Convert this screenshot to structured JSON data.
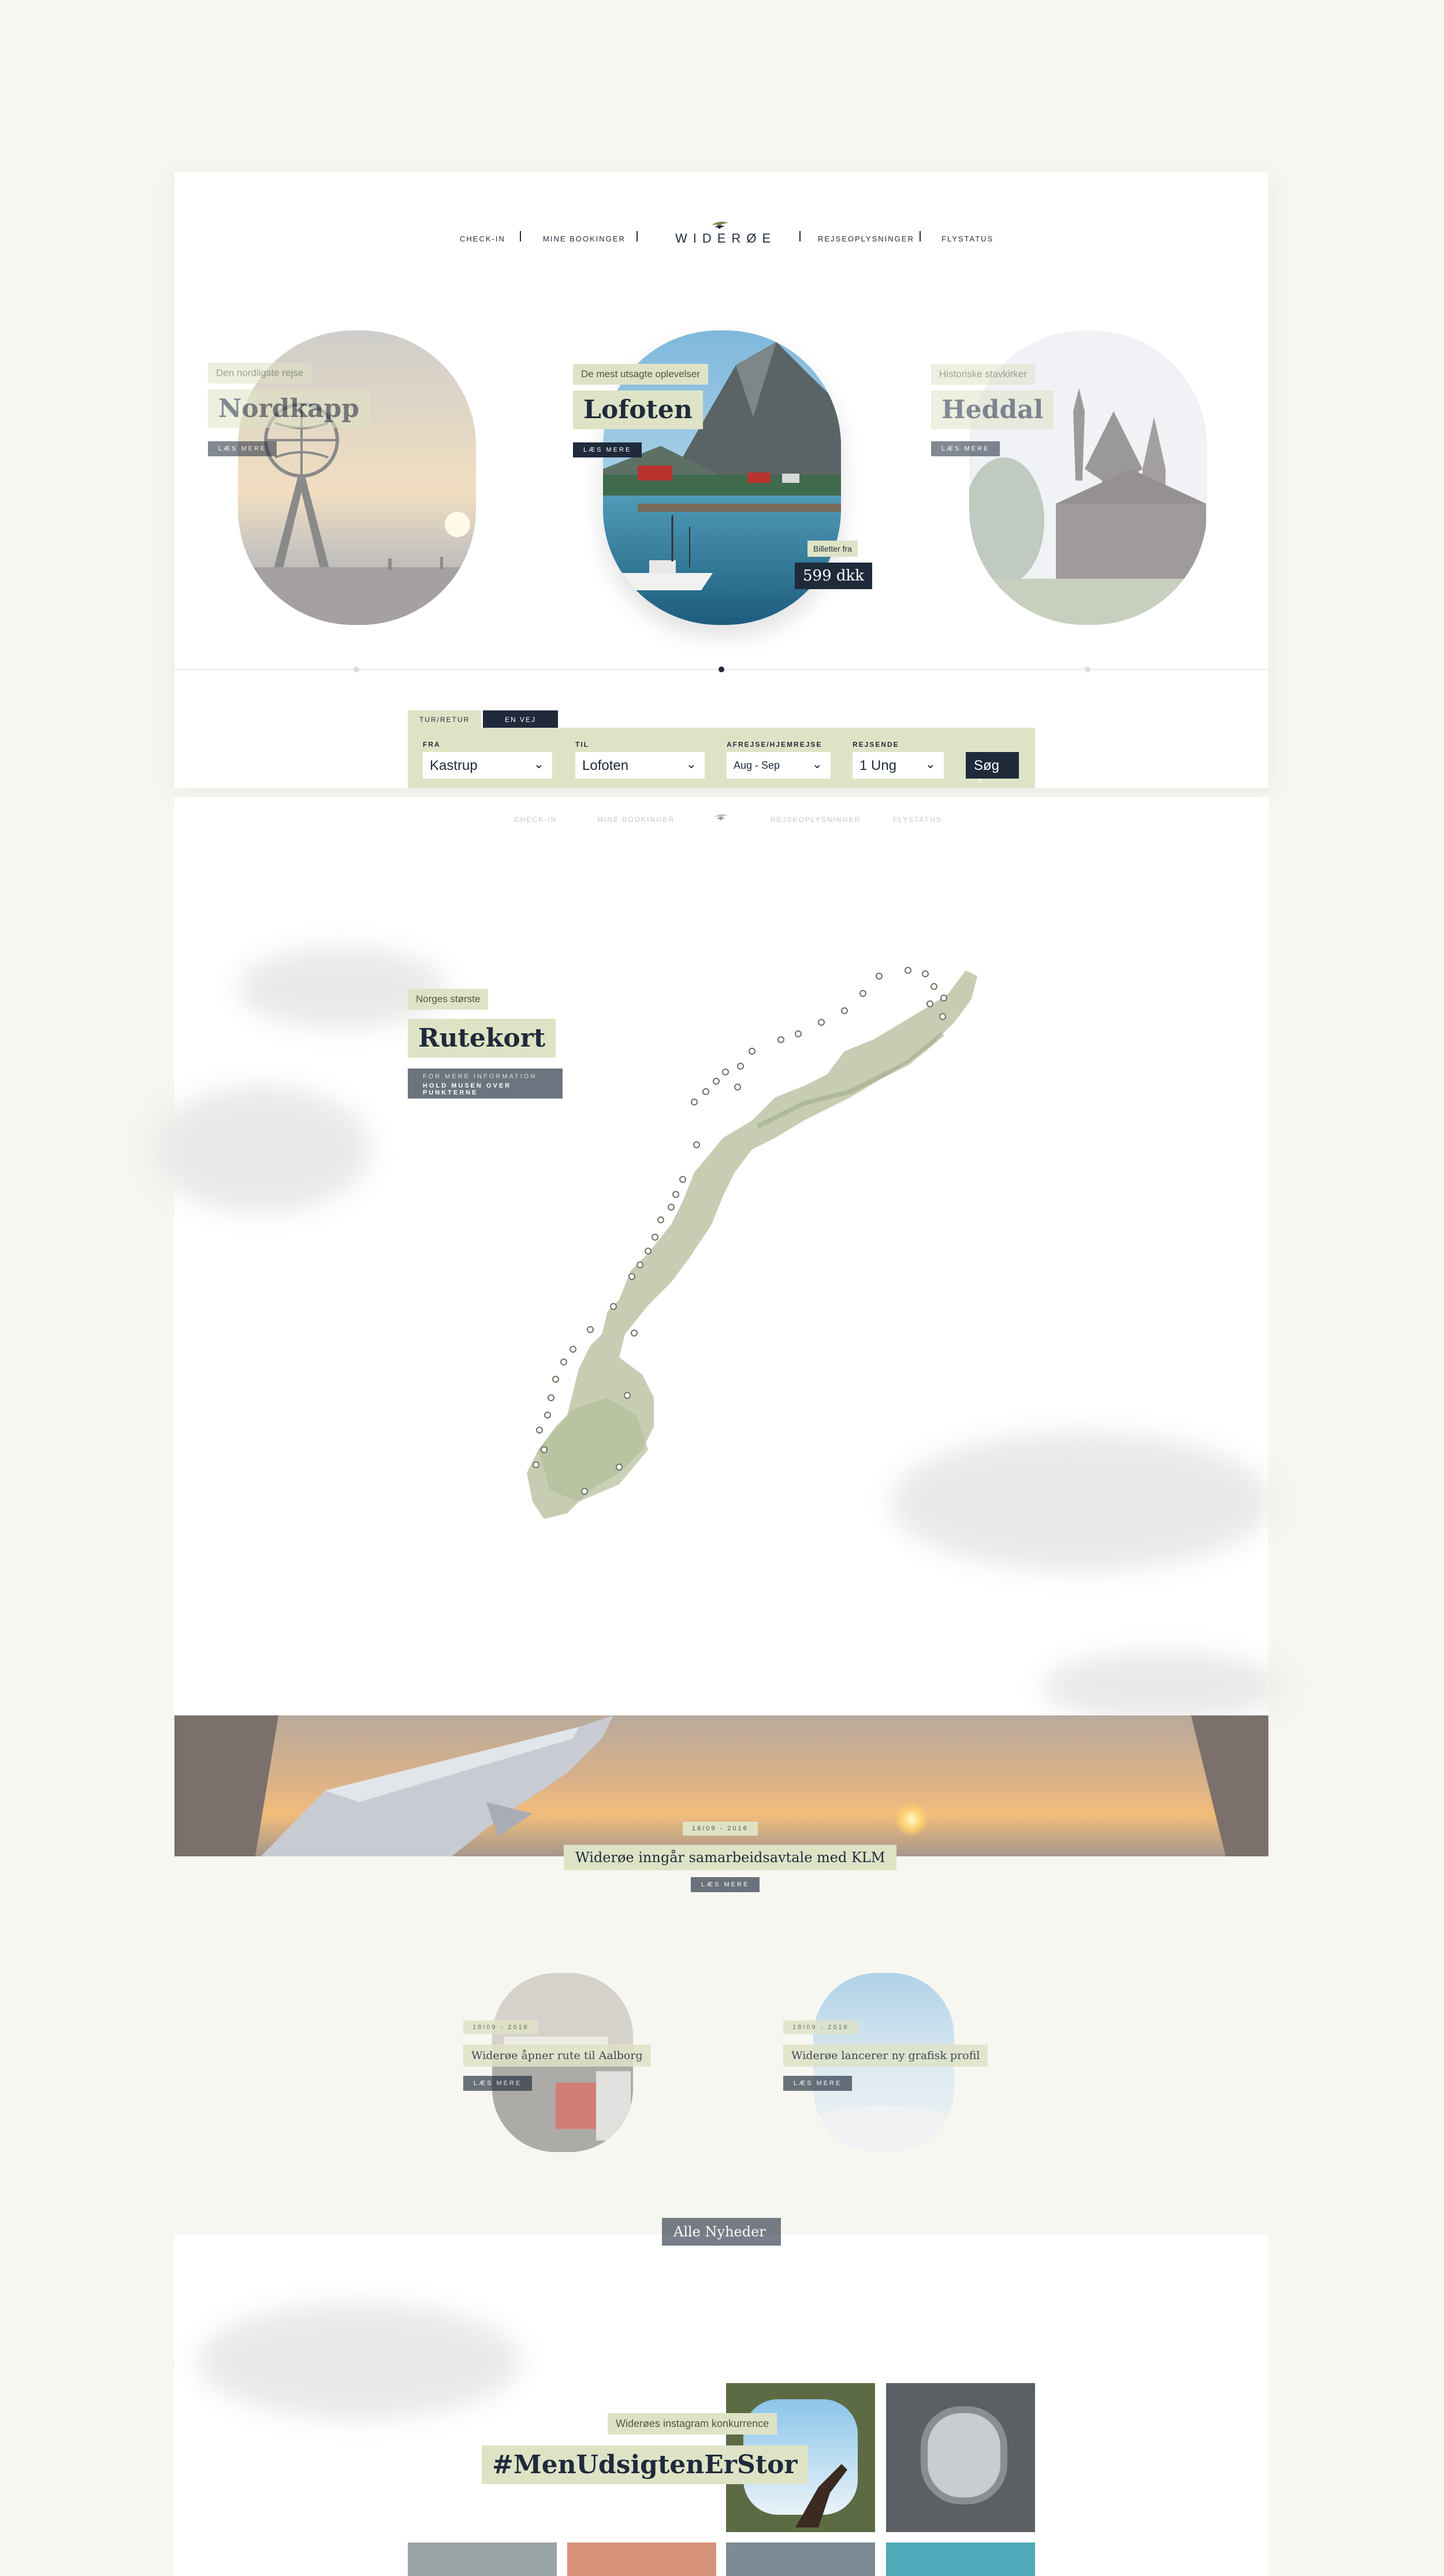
{
  "nav": {
    "checkin": "CHECK-IN",
    "bookings": "MINE BOOKINGER",
    "logo": "WIDERØE",
    "travel_info": "REJSEOPLYSNINGER",
    "flight_status": "FLYSTATUS"
  },
  "destinations": [
    {
      "subtitle": "Den nordligste rejse",
      "title": "Nordkapp",
      "more": "LÆS MERE"
    },
    {
      "subtitle": "De mest utsagte oplevelser",
      "title": "Lofoten",
      "more": "LÆS MERE",
      "price_label": "Billetter fra",
      "price": "599 dkk"
    },
    {
      "subtitle": "Historiske stavkirker",
      "title": "Heddal",
      "more": "LÆS MERE"
    }
  ],
  "booking": {
    "tabs": [
      "TUR/RETUR",
      "EN VEJ"
    ],
    "active_tab": "EN VEJ",
    "from_label": "FRA",
    "from_value": "Kastrup",
    "to_label": "TIL",
    "to_value": "Lofoten",
    "dates_label": "AFREJSE/HJEMREJSE",
    "dates_value": "Aug - Sep",
    "travelers_label": "REJSENDE",
    "travelers_value": "1 Ung",
    "search_button": "Søg"
  },
  "map": {
    "subtitle": "Norges største",
    "title": "Rutekort",
    "hint_line1": "FOR MERE INFORMATION",
    "hint_line2": "HOLD MUSEN OVER PUNKTERNE"
  },
  "featured_news": {
    "date": "18/09 - 2016",
    "title": "Widerøe inngår samarbeidsavtale med KLM",
    "more": "LÆS MERE"
  },
  "news": [
    {
      "date": "18/09 - 2016",
      "title": "Widerøe åpner rute til Aalborg",
      "more": "LÆS MERE"
    },
    {
      "date": "18/09 - 2016",
      "title": "Widerøe lancerer ny grafisk profil",
      "more": "LÆS MERE"
    }
  ],
  "all_news_button": "Alle Nyheder",
  "instagram": {
    "subtitle": "Widerøes instagram konkurrence",
    "hashtag": "#MenUdsigtenErStor"
  },
  "colors": {
    "navy": "#1f2a3b",
    "sage": "#dfe3c6",
    "page_bg": "#f7f7f1"
  }
}
